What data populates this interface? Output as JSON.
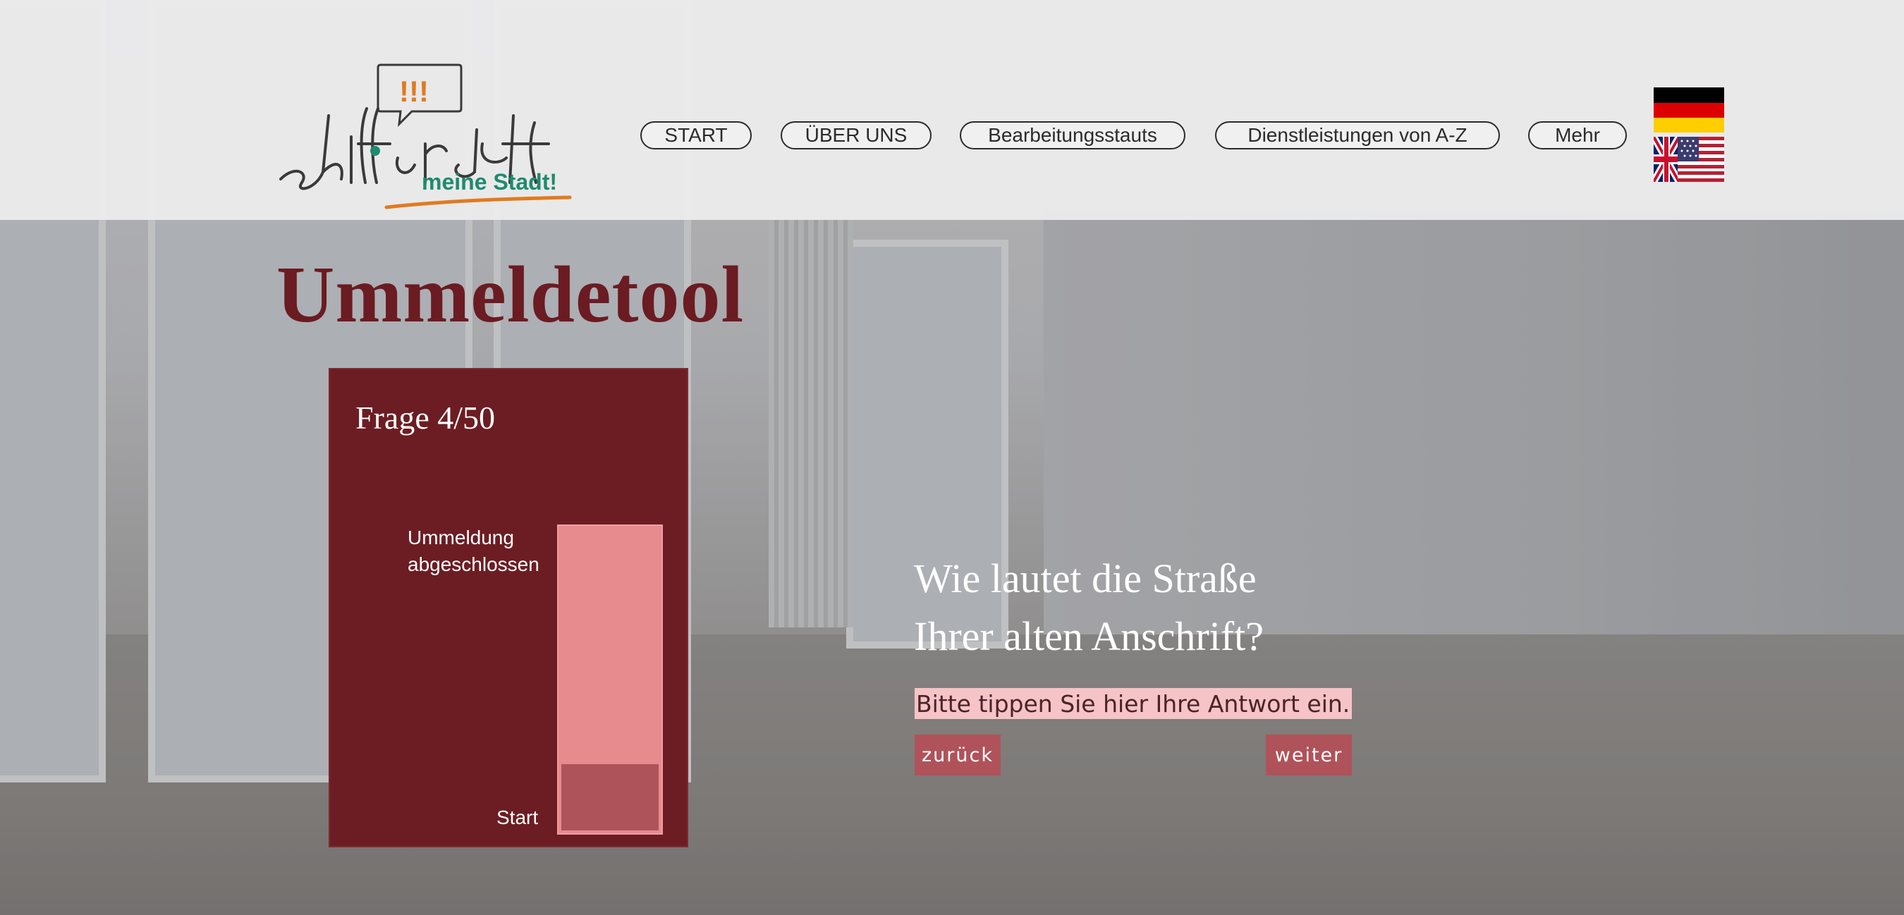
{
  "logo": {
    "exclamations": "!!!",
    "wordmark": "Schifferstadt",
    "tagline": "meine Stadt!",
    "colors": {
      "ink": "#3a3a3a",
      "accent_orange": "#e07b1f",
      "accent_teal": "#1f8a6e"
    }
  },
  "nav": {
    "items": [
      {
        "label": "START"
      },
      {
        "label": "ÜBER UNS"
      },
      {
        "label": "Bearbeitungsstauts"
      },
      {
        "label": "Dienstleistungen von A-Z"
      },
      {
        "label": "Mehr"
      }
    ]
  },
  "languages": [
    {
      "icon": "german-flag-icon"
    },
    {
      "icon": "uk-us-flag-icon"
    }
  ],
  "page": {
    "title": "Ummeldetool"
  },
  "progress": {
    "counter": "Frage 4/50",
    "goal_label": "Ummeldung abgeschlossen",
    "start_label": "Start",
    "fraction_filled": 0.22
  },
  "question": {
    "line1": "Wie lautet die Straße",
    "line2": "Ihrer alten Anschrift?",
    "placeholder": "Bitte tippen Sie hier Ihre Antwort ein.",
    "value": "",
    "back_label": "zurück",
    "next_label": "weiter"
  },
  "colors": {
    "brand_dark_red": "#6c1d23",
    "progress_track": "#e78b8e",
    "progress_fill": "#ad5359",
    "input_bg": "#f6c3c6",
    "button_bg": "#b0525a"
  }
}
